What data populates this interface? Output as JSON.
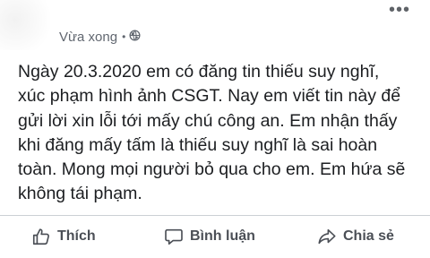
{
  "post": {
    "timestamp": "Vừa xong",
    "separator": "•",
    "privacy_icon": "globe-icon",
    "more_icon": "more-options-icon",
    "more_glyph": "•••",
    "text": "Ngày 20.3.2020 em có đăng tin thiếu suy nghĩ,\nxúc phạm hình ảnh CSGT. Nay em viết tin này để\ngửi lời xin lỗi tới mấy chú công an. Em nhận thấy\nkhi đăng mấy tấm  là thiếu suy nghĩ là sai hoàn\ntoàn. Mong mọi người bỏ qua cho em. Em hứa sẽ\nkhông tái phạm."
  },
  "actions": {
    "like_label": "Thích",
    "comment_label": "Bình luận",
    "share_label": "Chia sẻ"
  },
  "colors": {
    "text": "#1c1e21",
    "meta": "#616770",
    "action": "#4b4f56",
    "divider": "#ccd0d5"
  }
}
